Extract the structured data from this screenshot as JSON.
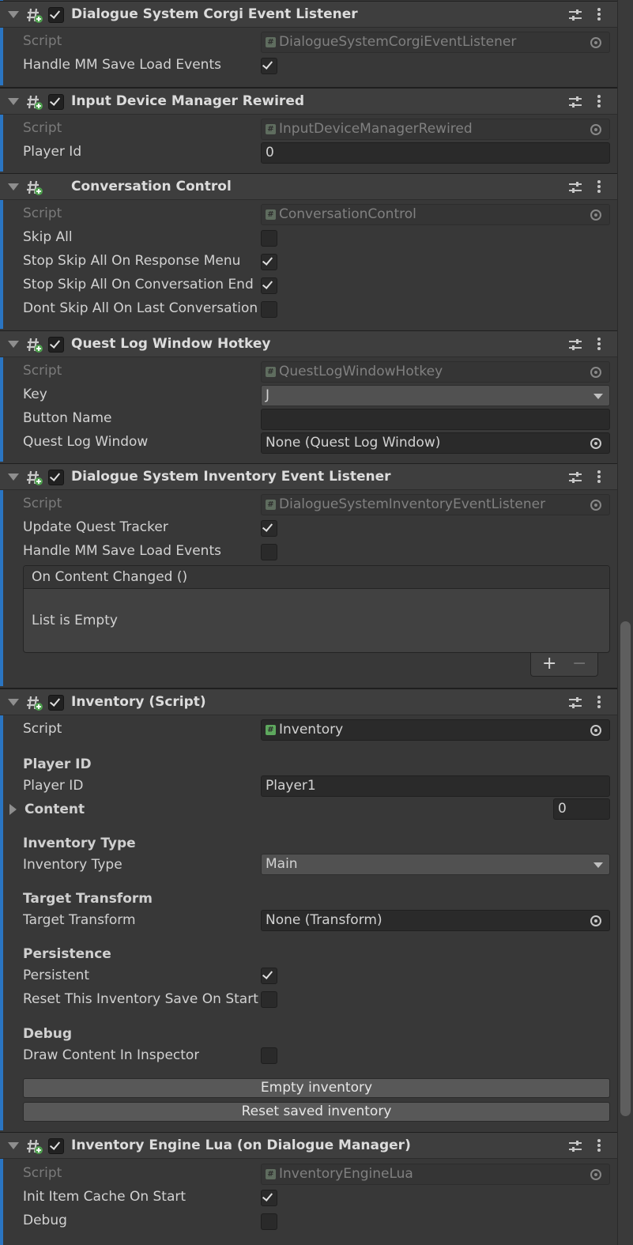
{
  "components": [
    {
      "title": "Dialogue System Corgi Event Listener",
      "enabled": true,
      "script": "DialogueSystemCorgiEventListener",
      "fields": [
        {
          "label": "Handle MM Save Load Events",
          "checked": true
        }
      ]
    },
    {
      "title": "Input Device Manager Rewired",
      "enabled": true,
      "script": "InputDeviceManagerRewired",
      "fields": [
        {
          "label": "Player Id",
          "value": "0"
        }
      ]
    },
    {
      "title": "Conversation Control",
      "enabled": null,
      "script": "ConversationControl",
      "fields": [
        {
          "label": "Skip All",
          "checked": false
        },
        {
          "label": "Stop Skip All On Response Menu",
          "checked": true
        },
        {
          "label": "Stop Skip All On Conversation End",
          "checked": true
        },
        {
          "label": "Dont Skip All On Last Conversation",
          "checked": false
        }
      ]
    },
    {
      "title": "Quest Log Window Hotkey",
      "enabled": true,
      "script": "QuestLogWindowHotkey",
      "fields": [
        {
          "label": "Key",
          "value": "J"
        },
        {
          "label": "Button Name",
          "value": ""
        },
        {
          "label": "Quest Log Window",
          "value": "None (Quest Log Window)"
        }
      ]
    },
    {
      "title": "Dialogue System Inventory Event Listener",
      "enabled": true,
      "script": "DialogueSystemInventoryEventListener",
      "fields": [
        {
          "label": "Update Quest Tracker",
          "checked": true
        },
        {
          "label": "Handle MM Save Load Events",
          "checked": false
        }
      ],
      "event": {
        "header": "On Content Changed ()",
        "empty_text": "List is Empty",
        "add": "+",
        "remove": "−"
      }
    },
    {
      "title": "Inventory (Script)",
      "enabled": true,
      "script": "Inventory",
      "sections": {
        "player_id_header": "Player ID",
        "player_id_label": "Player ID",
        "player_id_value": "Player1",
        "content_label": "Content",
        "content_count": "0",
        "inventory_type_header": "Inventory Type",
        "inventory_type_label": "Inventory Type",
        "inventory_type_value": "Main",
        "target_transform_header": "Target Transform",
        "target_transform_label": "Target Transform",
        "target_transform_value": "None (Transform)",
        "persistence_header": "Persistence",
        "persistent_label": "Persistent",
        "persistent_checked": true,
        "reset_label": "Reset This Inventory Save On Start",
        "reset_checked": false,
        "debug_header": "Debug",
        "draw_content_label": "Draw Content In Inspector",
        "draw_content_checked": false,
        "empty_button": "Empty inventory",
        "reset_button": "Reset saved inventory"
      }
    },
    {
      "title": "Inventory Engine Lua (on Dialogue Manager)",
      "enabled": true,
      "script": "InventoryEngineLua",
      "fields": [
        {
          "label": "Init Item Cache On Start",
          "checked": true
        },
        {
          "label": "Debug",
          "checked": false
        }
      ]
    }
  ],
  "script_label": "Script",
  "colors": {
    "accent": "#2a75c2",
    "background": "#383838",
    "header": "#3e3e3e",
    "field": "#2a2a2a"
  }
}
